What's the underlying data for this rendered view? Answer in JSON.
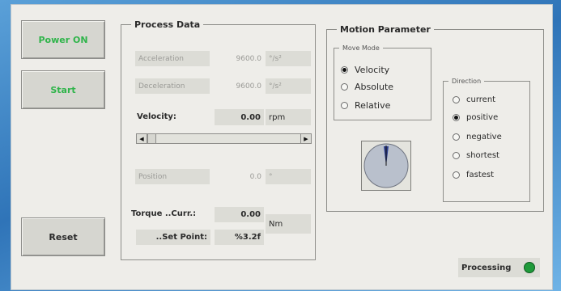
{
  "buttons": {
    "power_on": "Power ON",
    "start": "Start",
    "reset": "Reset"
  },
  "process_data": {
    "legend": "Process Data",
    "acceleration_label": "Acceleration",
    "acceleration_value": "9600.0",
    "acceleration_unit": "°/s²",
    "deceleration_label": "Deceleration",
    "deceleration_value": "9600.0",
    "deceleration_unit": "°/s²",
    "velocity_label": "Velocity:",
    "velocity_value": "0.00",
    "velocity_unit": "rpm",
    "position_label": "Position",
    "position_value": "0.0",
    "position_unit": "°",
    "torque_curr_label": "Torque ..Curr.:",
    "torque_curr_value": "0.00",
    "set_point_label": "..Set Point:",
    "set_point_value": "%3.2f",
    "torque_unit": "Nm"
  },
  "motion_parameter": {
    "legend": "Motion Parameter",
    "move_mode": {
      "legend": "Move Mode",
      "options": [
        "Velocity",
        "Absolute",
        "Relative"
      ],
      "selected": "Velocity"
    },
    "direction": {
      "legend": "Direction",
      "options": [
        "current",
        "positive",
        "negative",
        "shortest",
        "fastest"
      ],
      "selected": "positive"
    }
  },
  "status": {
    "processing_label": "Processing",
    "indicator_color": "#1f9a3a"
  }
}
